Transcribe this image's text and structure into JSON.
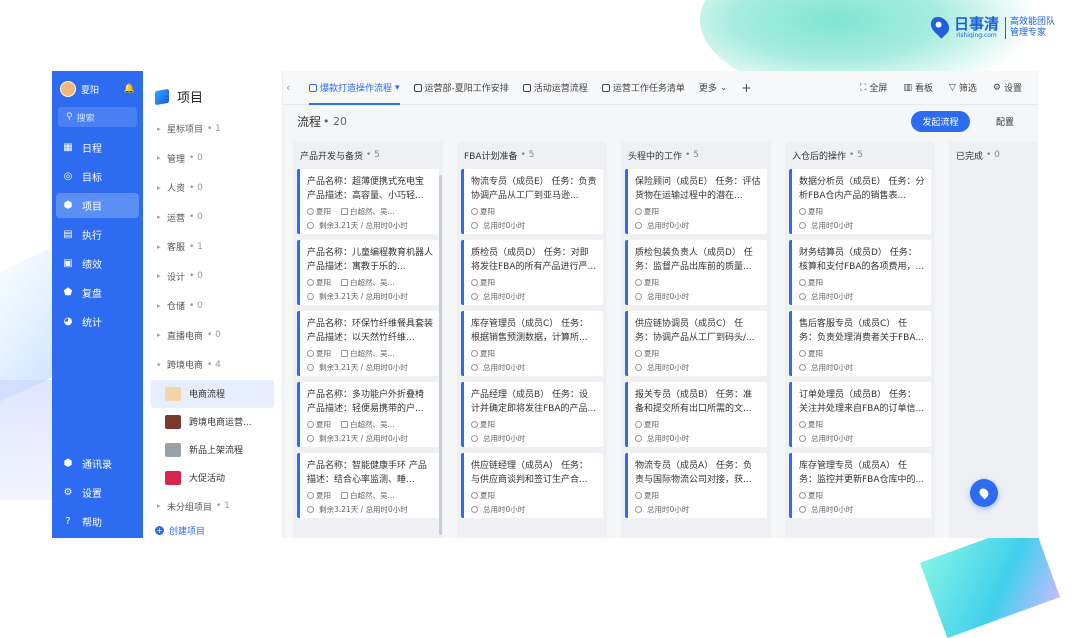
{
  "brand": {
    "name": "日事清",
    "url": "rishiqing.com",
    "slogan_line1": "高效能团队",
    "slogan_line2": "管理专家"
  },
  "rail": {
    "user_name": "夏阳",
    "search_placeholder": "搜索",
    "items": [
      {
        "label": "日程",
        "icon": "calendar-icon"
      },
      {
        "label": "目标",
        "icon": "target-icon"
      },
      {
        "label": "项目",
        "icon": "cube-icon",
        "active": true
      },
      {
        "label": "执行",
        "icon": "grid-icon"
      },
      {
        "label": "绩效",
        "icon": "performance-icon"
      },
      {
        "label": "复盘",
        "icon": "review-icon"
      },
      {
        "label": "统计",
        "icon": "pie-chart-icon"
      }
    ],
    "bottom_items": [
      {
        "label": "通讯录",
        "icon": "contacts-icon"
      },
      {
        "label": "设置",
        "icon": "gear-icon"
      },
      {
        "label": "帮助",
        "icon": "help-icon"
      }
    ]
  },
  "tree": {
    "title": "项目",
    "groups": [
      {
        "label": "星标项目",
        "count": "1"
      },
      {
        "label": "管理",
        "count": "0"
      },
      {
        "label": "人资",
        "count": "0"
      },
      {
        "label": "运营",
        "count": "0"
      },
      {
        "label": "客服",
        "count": "1"
      },
      {
        "label": "设计",
        "count": "0"
      },
      {
        "label": "仓储",
        "count": "0"
      },
      {
        "label": "直播电商",
        "count": "0"
      },
      {
        "label": "跨境电商",
        "count": "4"
      }
    ],
    "subitems": [
      {
        "label": "电商流程",
        "active": true,
        "color": "#f2d6a8"
      },
      {
        "label": "跨境电商运营...",
        "color": "#7a3b2e"
      },
      {
        "label": "新品上架流程",
        "color": "#9aa0a8"
      },
      {
        "label": "大促活动",
        "color": "#d8264c"
      }
    ],
    "ungrouped": {
      "label": "未分组项目",
      "count": "1"
    },
    "create_label": "创建项目"
  },
  "tabs": {
    "items": [
      {
        "label": "爆款打造操作流程",
        "active": true
      },
      {
        "label": "运营部-夏阳工作安排"
      },
      {
        "label": "活动运营流程"
      },
      {
        "label": "运营工作任务清单"
      }
    ],
    "more_label": "更多",
    "add_label": "+",
    "tools": [
      "全屏",
      "看板",
      "筛选",
      "设置"
    ]
  },
  "subhead": {
    "title": "流程",
    "count": "• 20"
  },
  "buttons": {
    "start_flow": "发起流程",
    "configure": "配置"
  },
  "columns": [
    {
      "title": "产品开发与备货",
      "count": "• 5",
      "cards": [
        {
          "text": "产品名称：超薄便携式充电宝 产品描述：高容量、小巧轻...",
          "owner": "夏阳",
          "project": "白超然、吴...",
          "due": "剩余3.21天 / 总用时0小时"
        },
        {
          "text": "产品名称：儿童编程教育机器人 产品描述：寓教于乐的...",
          "owner": "夏阳",
          "project": "白超然、吴...",
          "due": "剩余3.21天 / 总用时0小时"
        },
        {
          "text": "产品名称：环保竹纤维餐具套装 产品描述：以天然竹纤维...",
          "owner": "夏阳",
          "project": "白超然、吴...",
          "due": "剩余3.21天 / 总用时0小时"
        },
        {
          "text": "产品名称：多功能户外折叠椅 产品描述：轻便易携带的户...",
          "owner": "夏阳",
          "project": "白超然、吴...",
          "due": "剩余3.21天 / 总用时0小时"
        },
        {
          "text": "产品名称：智能健康手环 产品描述：结合心率监测、睡...",
          "owner": "夏阳",
          "project": "白超然、吴...",
          "due": "剩余3.21天 / 总用时0小时"
        }
      ]
    },
    {
      "title": "FBA计划准备",
      "count": "• 5",
      "cards": [
        {
          "text": "物流专员（成员E） 任务：负责协调产品从工厂到亚马逊...",
          "owner": "夏阳",
          "due": "总用时0小时"
        },
        {
          "text": "质检员（成员D） 任务：对即将发往FBA的所有产品进行严...",
          "owner": "夏阳",
          "due": "总用时0小时"
        },
        {
          "text": "库存管理员（成员C） 任务：根据销售预测数据，计算所...",
          "owner": "夏阳",
          "due": "总用时0小时"
        },
        {
          "text": "产品经理（成员B） 任务：设计并确定即将发往FBA的产品...",
          "owner": "夏阳",
          "due": "总用时0小时"
        },
        {
          "text": "供应链经理（成员A） 任务：与供应商谈判和签订生产合...",
          "owner": "夏阳",
          "due": "总用时0小时"
        }
      ]
    },
    {
      "title": "头程中的工作",
      "count": "• 5",
      "cards": [
        {
          "text": "保险顾问（成员E） 任务：评估货物在运输过程中的潜在...",
          "owner": "夏阳",
          "due": "总用时0小时"
        },
        {
          "text": "质检包装负责人（成员D） 任务：监督产品出库前的质量...",
          "owner": "夏阳",
          "due": "总用时0小时"
        },
        {
          "text": "供应链协调员（成员C） 任务：协调产品从工厂到码头/...",
          "owner": "夏阳",
          "due": "总用时0小时"
        },
        {
          "text": "报关专员（成员B） 任务：准备和提交所有出口所需的文...",
          "owner": "夏阳",
          "due": "总用时0小时"
        },
        {
          "text": "物流专员（成员A） 任务：负责与国际物流公司对接，获...",
          "owner": "夏阳",
          "due": "总用时0小时"
        }
      ]
    },
    {
      "title": "入仓后的操作",
      "count": "• 5",
      "cards": [
        {
          "text": "数据分析员（成员E） 任务：分析FBA仓内产品的销售表...",
          "owner": "夏阳",
          "due": "总用时0小时"
        },
        {
          "text": "财务结算员（成员D） 任务：核算和支付FBA的各项费用，...",
          "owner": "夏阳",
          "due": "总用时0小时"
        },
        {
          "text": "售后客服专员（成员C） 任务：负责处理消费者关于FBA...",
          "owner": "夏阳",
          "due": "总用时0小时"
        },
        {
          "text": "订单处理员（成员B） 任务：关注并处理来自FBA的订单信...",
          "owner": "夏阳",
          "due": "总用时0小时"
        },
        {
          "text": "库存管理专员（成员A） 任务：监控并更新FBA仓库中的...",
          "owner": "夏阳",
          "due": "总用时0小时"
        }
      ]
    },
    {
      "title": "已完成",
      "count": "• 0",
      "cards": []
    }
  ],
  "colors": {
    "accent": "#2d6bf0",
    "rail_bg": "#2d6bf0"
  }
}
